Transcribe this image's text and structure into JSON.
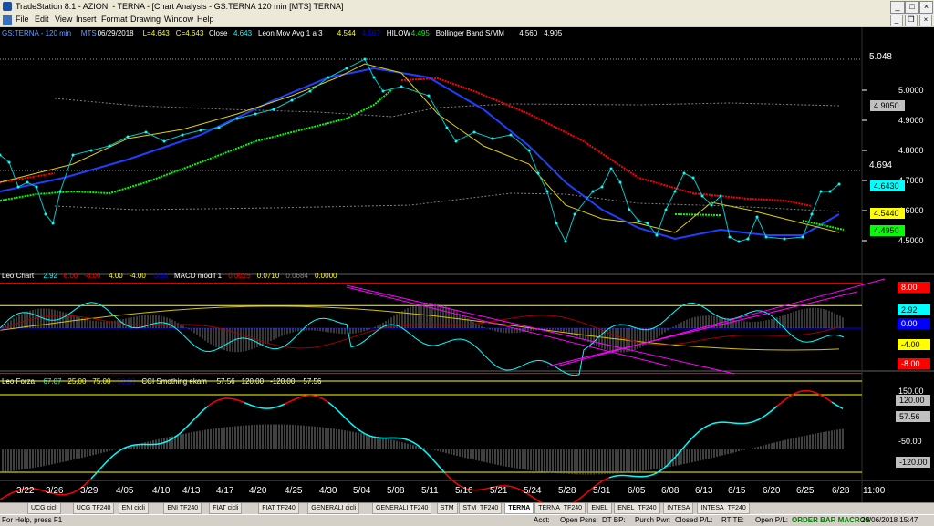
{
  "window": {
    "title": "TradeStation 8.1 - AZIONI - TERNA - [Chart Analysis - GS:TERNA  120 min  [MTS] TERNA]"
  },
  "menu": [
    "File",
    "Edit",
    "View",
    "Insert",
    "Format",
    "Drawing",
    "Window",
    "Help"
  ],
  "price_panel": {
    "header": [
      {
        "text": "GS:TERNA - 120 min",
        "color": "#5aa0ff"
      },
      {
        "text": "MTS",
        "color": "#5aa0ff"
      },
      {
        "text": "06/29/2018",
        "color": "#ffffff"
      },
      {
        "text": "L=4.643",
        "color": "#ffff00"
      },
      {
        "text": "C=4.643",
        "color": "#ffff00"
      },
      {
        "text": "Close",
        "color": "#ffffff"
      },
      {
        "text": "4.643",
        "color": "#00ffff"
      },
      {
        "text": "Leon Mov Avg 1 a 3",
        "color": "#ffffff"
      },
      {
        "text": "4.544",
        "color": "#ffff00"
      },
      {
        "text": "4.56?",
        "color": "#0000ff"
      },
      {
        "text": "HILOW",
        "color": "#ffffff"
      },
      {
        "text": "4.495",
        "color": "#00ff00"
      },
      {
        "text": "Bollinger Band S/MM",
        "color": "#ffffff"
      },
      {
        "text": "4.560",
        "color": "#ffffff"
      },
      {
        "text": "4.905",
        "color": "#ffffff"
      }
    ],
    "axis_ticks": [
      "5.0000",
      "4.9000",
      "4.8000",
      "4.7000",
      "4.6000",
      "4.5000"
    ],
    "level_labels": [
      "5.048",
      "4.694"
    ],
    "value_boxes": [
      {
        "text": "4.9050",
        "bg": "#c0c0c0",
        "fg": "#000000"
      },
      {
        "text": "4.6430",
        "bg": "#00ffff",
        "fg": "#000000"
      },
      {
        "text": "4.5440",
        "bg": "#ffff00",
        "fg": "#000000"
      },
      {
        "text": "4.4950",
        "bg": "#00ff00",
        "fg": "#000000"
      }
    ]
  },
  "leo_chart_panel": {
    "header": [
      {
        "text": "Leo Chart",
        "color": "#ffffff"
      },
      {
        "text": "2.92",
        "color": "#00ffff"
      },
      {
        "text": "8.00",
        "color": "#ff0000"
      },
      {
        "text": "-8.00",
        "color": "#ff0000"
      },
      {
        "text": "4.00",
        "color": "#ffff00"
      },
      {
        "text": "-4.00",
        "color": "#ffff00"
      },
      {
        "text": "0.00",
        "color": "#0000ff"
      },
      {
        "text": "MACD modif 1",
        "color": "#ffffff"
      },
      {
        "text": "0.0025",
        "color": "#ff0000"
      },
      {
        "text": "0.0710",
        "color": "#ffff00"
      },
      {
        "text": "0.0684",
        "color": "#808080"
      },
      {
        "text": "0.0000",
        "color": "#ffff00"
      }
    ],
    "value_boxes": [
      {
        "text": "8.00",
        "bg": "#ff0000",
        "fg": "#ffffff"
      },
      {
        "text": "2.92",
        "bg": "#00ffff",
        "fg": "#000000"
      },
      {
        "text": "0.00",
        "bg": "#0000ff",
        "fg": "#ffffff"
      },
      {
        "text": "-4.00",
        "bg": "#ffff00",
        "fg": "#000000"
      },
      {
        "text": "-8.00",
        "bg": "#ff0000",
        "fg": "#ffffff"
      }
    ]
  },
  "leo_forza_panel": {
    "header": [
      {
        "text": "Leo Forza",
        "color": "#ffffff"
      },
      {
        "text": "67.07",
        "color": "#00ffff"
      },
      {
        "text": "25.00",
        "color": "#ffff00"
      },
      {
        "text": "75.00",
        "color": "#ffff00"
      },
      {
        "text": "50.00",
        "color": "#0000ff"
      },
      {
        "text": "CCI Smothing ekam",
        "color": "#ffffff"
      },
      {
        "text": "57.56",
        "color": "#ffffff"
      },
      {
        "text": "120.00",
        "color": "#ffffff"
      },
      {
        "text": "-120.00",
        "color": "#ffffff"
      },
      {
        "text": "57.56",
        "color": "#ffffff"
      }
    ],
    "axis_ticks": [
      "150.00",
      "-50.00",
      "-120.00"
    ],
    "value_boxes": [
      {
        "text": "120.00",
        "bg": "#c0c0c0",
        "fg": "#000000"
      },
      {
        "text": "57.56",
        "bg": "#c0c0c0",
        "fg": "#000000"
      },
      {
        "text": "-120.00",
        "bg": "#c0c0c0",
        "fg": "#000000"
      }
    ]
  },
  "date_axis": [
    "3/22",
    "3/26",
    "3/29",
    "4/05",
    "4/10",
    "4/13",
    "4/17",
    "4/20",
    "4/25",
    "4/30",
    "5/04",
    "5/08",
    "5/11",
    "5/16",
    "5/21",
    "5/24",
    "5/28",
    "5/31",
    "6/05",
    "6/08",
    "6/13",
    "6/15",
    "6/20",
    "6/25",
    "6/28",
    "11:00"
  ],
  "tabs": [
    "UCG cicli",
    "UCG TF240",
    "ENI cicli",
    "ENI TF240",
    "FIAT cicli",
    "FIAT TF240",
    "GENERALI cicli",
    "GENERALI TF240",
    "STM",
    "STM_TF240",
    "TERNA",
    "TERNA_TF240",
    "ENEL",
    "ENEL_TF240",
    "INTESA",
    "INTESA_TF240"
  ],
  "active_tab": "TERNA",
  "status": {
    "help": "For Help, press F1",
    "acct": "Acct:",
    "open_psns": "Open Psns:",
    "dt_bp": "DT BP:",
    "purch_pwr": "Purch Pwr:",
    "closed_pl": "Closed P/L:",
    "rt_te": "RT TE:",
    "open_pl": "Open P/L:",
    "macros": "ORDER BAR  MACROS",
    "datetime": "29/06/2018 15:47"
  },
  "colors": {
    "price_dots": "#00ffff",
    "bg": "#000000",
    "ma_red": "#ff0000",
    "ma_blue": "#1f3fff",
    "hilow": "#00ff00"
  }
}
